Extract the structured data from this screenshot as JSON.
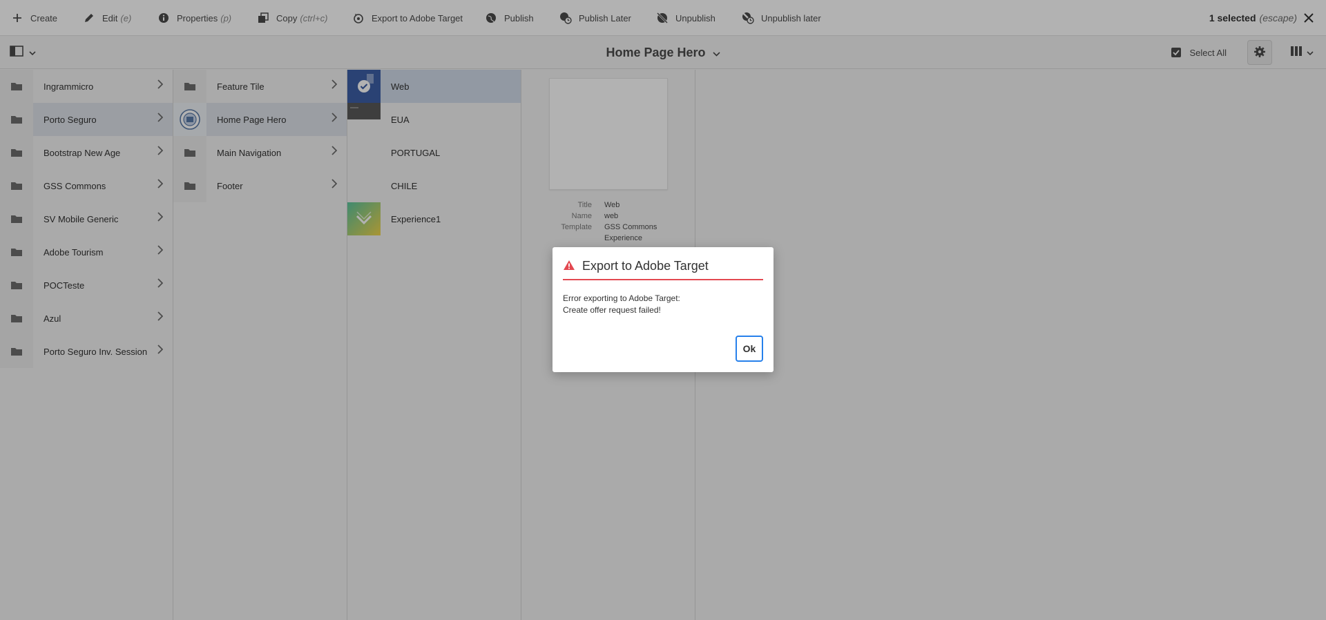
{
  "actionbar": {
    "create": "Create",
    "edit": "Edit",
    "edit_shortcut": "(e)",
    "properties": "Properties",
    "properties_shortcut": "(p)",
    "copy": "Copy",
    "copy_shortcut": "(ctrl+c)",
    "export": "Export to Adobe Target",
    "publish": "Publish",
    "publish_later": "Publish Later",
    "unpublish": "Unpublish",
    "unpublish_later": "Unpublish later",
    "selected_count": "1 selected",
    "escape_hint": "(escape)"
  },
  "titlebar": {
    "title": "Home Page Hero",
    "select_all": "Select All"
  },
  "columns": {
    "col1": [
      {
        "label": "Ingrammicro"
      },
      {
        "label": "Porto Seguro"
      },
      {
        "label": "Bootstrap New Age"
      },
      {
        "label": "GSS Commons"
      },
      {
        "label": "SV Mobile Generic"
      },
      {
        "label": "Adobe Tourism"
      },
      {
        "label": "POCTeste"
      },
      {
        "label": "Azul"
      },
      {
        "label": "Porto Seguro Inv. Session"
      }
    ],
    "col2": [
      {
        "label": "Feature Tile"
      },
      {
        "label": "Home Page Hero"
      },
      {
        "label": "Main Navigation"
      },
      {
        "label": "Footer"
      }
    ],
    "col3": [
      {
        "label": "Web"
      },
      {
        "label": "EUA"
      },
      {
        "label": "PORTUGAL"
      },
      {
        "label": "CHILE"
      },
      {
        "label": "Experience1"
      }
    ]
  },
  "preview": {
    "title_key": "Title",
    "title_val": "Web",
    "name_key": "Name",
    "name_val": "web",
    "template_key": "Template",
    "template_val_1": "GSS Commons",
    "template_val_2": "Experience"
  },
  "dialog": {
    "title": "Export to Adobe Target",
    "line1": "Error exporting to Adobe Target:",
    "line2": "Create offer request failed!",
    "ok": "Ok"
  },
  "colors": {
    "accent": "#2680eb",
    "error": "#e34850"
  }
}
